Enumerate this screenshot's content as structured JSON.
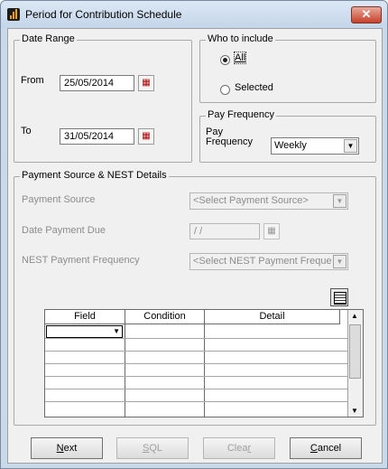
{
  "window": {
    "title": "Period for Contribution Schedule",
    "close_symbol": "✕"
  },
  "date_range": {
    "title": "Date Range",
    "from_label": "From",
    "from_value": "25/05/2014",
    "to_label": "To",
    "to_value": "31/05/2014",
    "calendar_glyph": "▦"
  },
  "who_to_include": {
    "title": "Who to include",
    "all_label": "All",
    "selected_label": "Selected",
    "selected_option": "All"
  },
  "pay_frequency": {
    "title": "Pay Frequency",
    "label_line1": "Pay",
    "label_line2": "Frequency",
    "value": "Weekly"
  },
  "payment_source": {
    "title": "Payment Source & NEST Details",
    "source_label": "Payment Source",
    "source_value": "<Select Payment Source>",
    "date_due_label": "Date Payment Due",
    "date_due_value": "/ /",
    "nest_freq_label": "NEST Payment Frequency",
    "nest_freq_value": "<Select NEST Payment Freque"
  },
  "grid": {
    "columns": [
      "Field",
      "Condition",
      "Detail"
    ]
  },
  "buttons": {
    "next": "Next",
    "next_key": "N",
    "next_rest": "ext",
    "sql": "SQL",
    "sql_key": "S",
    "sql_rest": "QL",
    "clear_pre": "Clea",
    "clear_key": "r",
    "cancel": "Cancel",
    "cancel_key": "C",
    "cancel_rest": "ancel"
  },
  "icons": [
    "calendar-icon",
    "dropdown-arrow-icon",
    "grid-tools-icon",
    "scroll-up-icon",
    "scroll-down-icon",
    "app-icon",
    "close-icon"
  ]
}
